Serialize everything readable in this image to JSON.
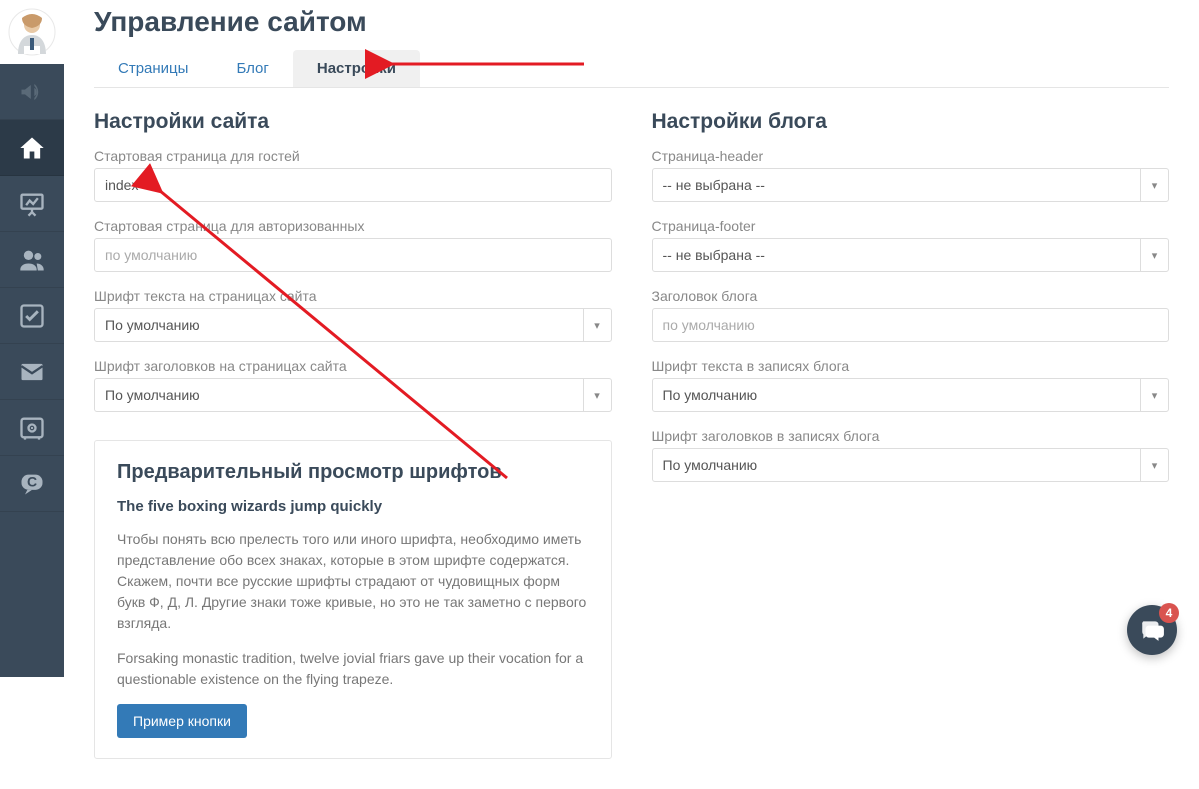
{
  "page_title": "Управление сайтом",
  "tabs": [
    {
      "label": "Страницы"
    },
    {
      "label": "Блог"
    },
    {
      "label": "Настройки"
    }
  ],
  "site_settings": {
    "title": "Настройки сайта",
    "guest_start_label": "Стартовая страница для гостей",
    "guest_start_value": "index",
    "auth_start_label": "Стартовая страница для авторизованных",
    "auth_start_placeholder": "по умолчанию",
    "text_font_label": "Шрифт текста на страницах сайта",
    "text_font_value": "По умолчанию",
    "heading_font_label": "Шрифт заголовков на страницах сайта",
    "heading_font_value": "По умолчанию"
  },
  "blog_settings": {
    "title": "Настройки блога",
    "header_page_label": "Страница-header",
    "header_page_value": "-- не выбрана --",
    "footer_page_label": "Страница-footer",
    "footer_page_value": "-- не выбрана --",
    "blog_title_label": "Заголовок блога",
    "blog_title_placeholder": "по умолчанию",
    "text_font_label": "Шрифт текста в записях блога",
    "text_font_value": "По умолчанию",
    "heading_font_label": "Шрифт заголовков в записях блога",
    "heading_font_value": "По умолчанию"
  },
  "preview": {
    "title": "Предварительный просмотр шрифтов",
    "subtitle": "The five boxing wizards jump quickly",
    "p1": "Чтобы понять всю прелесть того или иного шрифта, необходимо иметь представление обо всех знаках, которые в этом шрифте содержатся. Скажем, почти все русские шрифты страдают от чудовищных форм букв Ф, Д, Л. Другие знаки тоже кривые, но это не так заметно с первого взгляда.",
    "p2": "Forsaking monastic tradition, twelve jovial friars gave up their vocation for a questionable existence on the flying trapeze.",
    "button_label": "Пример кнопки"
  },
  "fab_badge": "4"
}
